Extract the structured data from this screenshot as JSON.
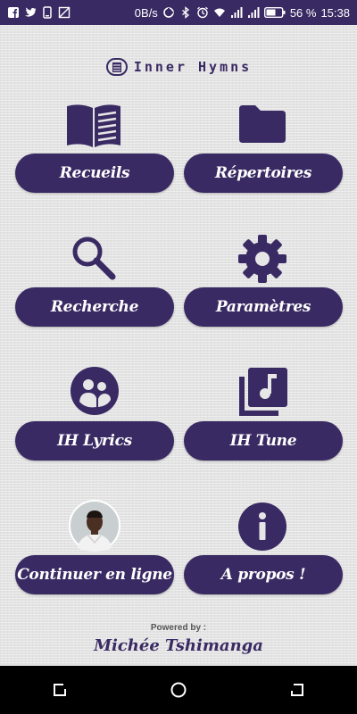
{
  "status_bar": {
    "speed": "0B/s",
    "battery": "56 %",
    "time": "15:38",
    "left_icons": [
      "facebook-icon",
      "twitter-icon",
      "phone-icon",
      "no-sim-icon"
    ],
    "right_icons": [
      "data-saver-icon",
      "bluetooth-icon",
      "alarm-icon",
      "wifi-icon",
      "signal-icon",
      "signal-icon",
      "battery-icon"
    ]
  },
  "app": {
    "title": "Inner Hymns",
    "accent": "#3a2a63"
  },
  "menu": {
    "recueils": "Recueils",
    "repertoires": "Répertoires",
    "recherche": "Recherche",
    "parametres": "Paramètres",
    "lyrics": "IH Lyrics",
    "tune": "IH Tune",
    "continuer": "Continuer en ligne",
    "apropos": "A propos !"
  },
  "footer": {
    "powered": "Powered by :",
    "author": "Michée Tshimanga"
  }
}
